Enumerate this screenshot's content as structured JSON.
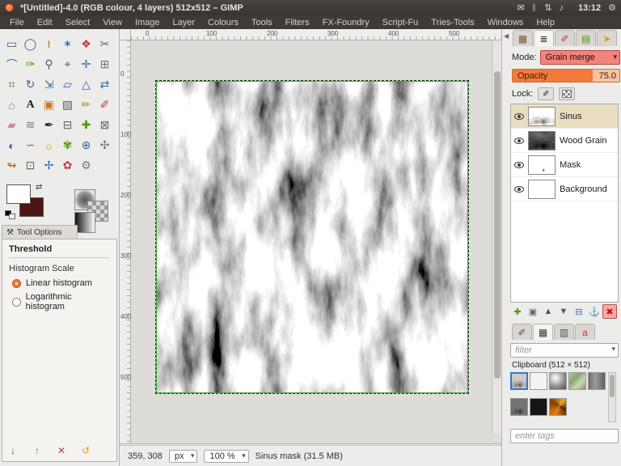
{
  "titlebar": {
    "title": "*[Untitled]-4.0 (RGB colour, 4 layers) 512x512 – GIMP",
    "time": "13:12",
    "tray_icons": [
      {
        "name": "mail-icon",
        "glyph": "✉"
      },
      {
        "name": "bluetooth-icon",
        "glyph": "ᛒ"
      },
      {
        "name": "network-icon",
        "glyph": "⇅"
      },
      {
        "name": "volume-icon",
        "glyph": "♪"
      }
    ],
    "session_icon": {
      "name": "gear-icon",
      "glyph": "⚙"
    }
  },
  "menubar": [
    "File",
    "Edit",
    "Select",
    "View",
    "Image",
    "Layer",
    "Colours",
    "Tools",
    "Filters",
    "FX-Foundry",
    "Script-Fu",
    "Tries-Tools",
    "Windows",
    "Help"
  ],
  "toolbox": {
    "tools": [
      {
        "name": "rectangle-select",
        "glyph": "▭",
        "color": "#55606e"
      },
      {
        "name": "ellipse-select",
        "glyph": "◯",
        "color": "#55606e"
      },
      {
        "name": "free-select",
        "glyph": "≀",
        "color": "#b0620a"
      },
      {
        "name": "fuzzy-select",
        "glyph": "✶",
        "color": "#2a6fb8"
      },
      {
        "name": "select-by-color",
        "glyph": "❖",
        "color": "#c03a3a"
      },
      {
        "name": "scissors-select",
        "glyph": "✂",
        "color": "#666"
      },
      {
        "name": "paths",
        "glyph": "⌒",
        "color": "#3465a4"
      },
      {
        "name": "color-picker",
        "glyph": "✑",
        "color": "#4e9a06"
      },
      {
        "name": "zoom",
        "glyph": "⚲",
        "color": "#555"
      },
      {
        "name": "measure",
        "glyph": "⌖",
        "color": "#555"
      },
      {
        "name": "move",
        "glyph": "✛",
        "color": "#3465a4"
      },
      {
        "name": "align",
        "glyph": "⊞",
        "color": "#777"
      },
      {
        "name": "crop",
        "glyph": "⌗",
        "color": "#8a5a2a"
      },
      {
        "name": "rotate",
        "glyph": "↻",
        "color": "#3465a4"
      },
      {
        "name": "scale",
        "glyph": "⇲",
        "color": "#3465a4"
      },
      {
        "name": "shear",
        "glyph": "▱",
        "color": "#3465a4"
      },
      {
        "name": "perspective",
        "glyph": "△",
        "color": "#3465a4"
      },
      {
        "name": "flip",
        "glyph": "⇄",
        "color": "#3465a4"
      },
      {
        "name": "cage-transform",
        "glyph": "⌂",
        "color": "#777"
      },
      {
        "name": "text",
        "glyph": "A",
        "color": "#1a1a1a"
      },
      {
        "name": "bucket-fill",
        "glyph": "▣",
        "color": "#d0751a"
      },
      {
        "name": "gradient",
        "glyph": "▨",
        "color": "#55606e"
      },
      {
        "name": "pencil",
        "glyph": "✏",
        "color": "#b08a2a"
      },
      {
        "name": "paintbrush",
        "glyph": "✐",
        "color": "#c03a3a"
      },
      {
        "name": "eraser",
        "glyph": "▰",
        "color": "#d08aa0"
      },
      {
        "name": "airbrush",
        "glyph": "≋",
        "color": "#777"
      },
      {
        "name": "ink",
        "glyph": "✒",
        "color": "#222"
      },
      {
        "name": "clone",
        "glyph": "⊟",
        "color": "#666"
      },
      {
        "name": "heal",
        "glyph": "✚",
        "color": "#4e9a06"
      },
      {
        "name": "perspective-clone",
        "glyph": "⊠",
        "color": "#666"
      },
      {
        "name": "blur-sharpen",
        "glyph": "◐",
        "color": "#3465a4"
      },
      {
        "name": "smudge",
        "glyph": "∽",
        "color": "#b0620a"
      },
      {
        "name": "dodge-burn",
        "glyph": "☼",
        "color": "#d0a016"
      },
      {
        "name": "foreground-select",
        "glyph": "✾",
        "color": "#4e9a06"
      },
      {
        "name": "unified-transform",
        "glyph": "⊕",
        "color": "#3465a4"
      },
      {
        "name": "handle-transform",
        "glyph": "✣",
        "color": "#777"
      },
      {
        "name": "warp-transform",
        "glyph": "↬",
        "color": "#b0620a"
      },
      {
        "name": "seamless-clone",
        "glyph": "⊡",
        "color": "#666"
      },
      {
        "name": "n-point-deformation",
        "glyph": "✢",
        "color": "#2a6fb8"
      },
      {
        "name": "mypaint-brush",
        "glyph": "✿",
        "color": "#c03a3a"
      },
      {
        "name": "gegl-operation",
        "glyph": "⚙",
        "color": "#777"
      }
    ],
    "foreground_color": "#ffffff",
    "background_color": "#4e1414"
  },
  "tool_options": {
    "tab": "Tool Options",
    "title": "Threshold",
    "section": "Histogram Scale",
    "options": [
      {
        "label": "Linear histogram",
        "selected": true
      },
      {
        "label": "Logarithmic histogram",
        "selected": false
      }
    ],
    "presets": [
      {
        "name": "save-preset-button",
        "glyph": "↓",
        "color": "#3465a4"
      },
      {
        "name": "restore-preset-button",
        "glyph": "↑",
        "color": "#4e9a06"
      },
      {
        "name": "delete-preset-button",
        "glyph": "✕",
        "color": "#c03a3a"
      },
      {
        "name": "reset-button",
        "glyph": "↺",
        "color": "#d0a016"
      }
    ]
  },
  "rulers": {
    "horizontal": [
      "0",
      "100",
      "200",
      "300",
      "400",
      "500"
    ],
    "vertical": [
      "0",
      "100",
      "200",
      "300",
      "400",
      "500"
    ]
  },
  "layers_panel": {
    "dialog_tabs": [
      {
        "name": "tab-palettes",
        "glyph": "▦",
        "active": false,
        "color": "#7a5a2a"
      },
      {
        "name": "tab-layers",
        "glyph": "≣",
        "active": true,
        "color": "#333"
      },
      {
        "name": "tab-channels",
        "glyph": "✐",
        "active": false,
        "color": "#c03a3a"
      },
      {
        "name": "tab-paths",
        "glyph": "▤",
        "active": false,
        "color": "#4e9a06"
      },
      {
        "name": "tab-pointer",
        "glyph": "➤",
        "active": false,
        "color": "#d0a016"
      }
    ],
    "mode_label": "Mode:",
    "mode_value": "Grain merge",
    "opacity_label": "Opacity",
    "opacity_value": "75.0",
    "opacity_percent": 75,
    "lock_label": "Lock:",
    "layers": [
      {
        "name": "Sinus",
        "thumb": "sinus",
        "selected": true,
        "visible": true
      },
      {
        "name": "Wood Grain",
        "thumb": "wood",
        "selected": false,
        "visible": true
      },
      {
        "name": "Mask",
        "thumb": "mask",
        "selected": false,
        "visible": true
      },
      {
        "name": "Background",
        "thumb": "white",
        "selected": false,
        "visible": true
      }
    ],
    "footer_buttons": [
      {
        "name": "new-layer-button",
        "glyph": "✚",
        "color": "#4e9a06",
        "highlight": false
      },
      {
        "name": "new-group-button",
        "glyph": "▣",
        "color": "#666",
        "highlight": false
      },
      {
        "name": "raise-layer-button",
        "glyph": "▲",
        "color": "#555",
        "highlight": false
      },
      {
        "name": "lower-layer-button",
        "glyph": "▼",
        "color": "#555",
        "highlight": false
      },
      {
        "name": "duplicate-layer-button",
        "glyph": "⊟",
        "color": "#3465a4",
        "highlight": false
      },
      {
        "name": "anchor-layer-button",
        "glyph": "⚓",
        "color": "#555",
        "highlight": false
      },
      {
        "name": "delete-layer-button",
        "glyph": "✖",
        "color": "#c01010",
        "highlight": true
      }
    ],
    "accent_colors": {
      "mode_combo": "#f2837d",
      "opacity_fill": "#f4793b",
      "selected_row": "#e9ddc2"
    }
  },
  "patterns_panel": {
    "dialog_tabs": [
      {
        "name": "tab-brushes",
        "glyph": "✐",
        "active": false,
        "color": "#555"
      },
      {
        "name": "tab-patterns",
        "glyph": "▦",
        "active": true,
        "color": "#333"
      },
      {
        "name": "tab-gradients",
        "glyph": "▥",
        "active": false,
        "color": "#555"
      },
      {
        "name": "tab-fonts",
        "glyph": "a",
        "active": false,
        "color": "#c03a3a"
      }
    ],
    "filter_placeholder": "filter",
    "selected_label": "Clipboard (512 × 512)",
    "patterns": [
      {
        "name": "clipboard-pattern",
        "style": "noise",
        "selected": true
      },
      {
        "name": "paper-pattern",
        "style": "paper",
        "selected": false
      },
      {
        "name": "sphere-pattern",
        "style": "sphere",
        "selected": false
      },
      {
        "name": "leaves-pattern",
        "style": "leaves",
        "selected": false
      },
      {
        "name": "slate-pattern",
        "style": "slate",
        "selected": false
      },
      {
        "name": "dark-noise-pattern",
        "style": "noise2",
        "selected": false
      },
      {
        "name": "ink-pattern",
        "style": "ink",
        "selected": false
      },
      {
        "name": "swirl-pattern",
        "style": "swirl",
        "selected": false
      }
    ],
    "tags_placeholder": "enter tags"
  },
  "statusbar": {
    "position": "359, 308",
    "unit": "px",
    "zoom": "100 %",
    "message": "Sinus mask (31.5 MB)"
  }
}
